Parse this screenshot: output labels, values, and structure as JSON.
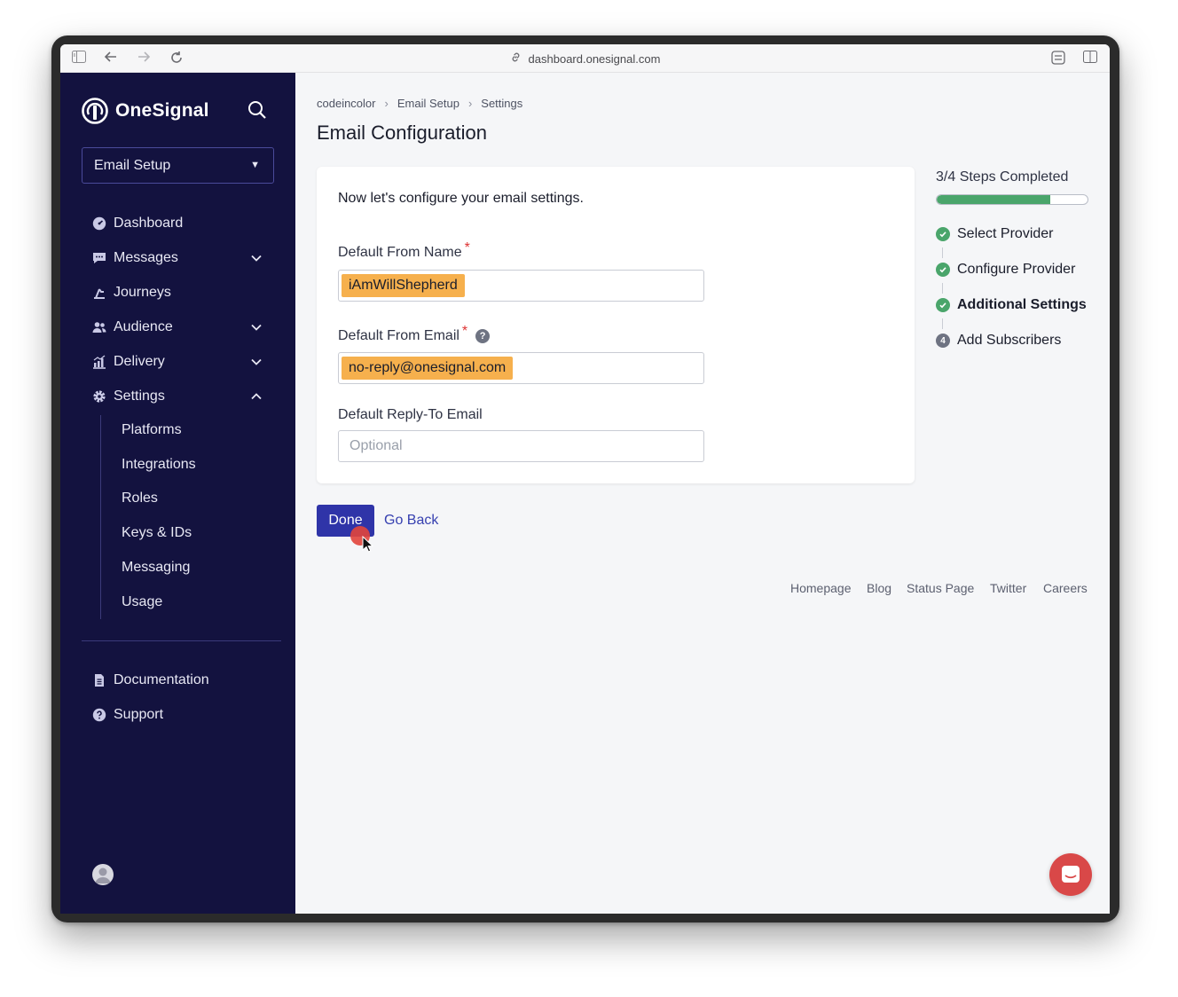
{
  "browser": {
    "url": "dashboard.onesignal.com"
  },
  "sidebar": {
    "brand": "OneSignal",
    "app_selector": "Email Setup",
    "nav": [
      {
        "label": "Dashboard"
      },
      {
        "label": "Messages"
      },
      {
        "label": "Journeys"
      },
      {
        "label": "Audience"
      },
      {
        "label": "Delivery"
      },
      {
        "label": "Settings"
      }
    ],
    "settings_subnav": [
      "Platforms",
      "Integrations",
      "Roles",
      "Keys & IDs",
      "Messaging",
      "Usage"
    ],
    "bottom": [
      {
        "label": "Documentation"
      },
      {
        "label": "Support"
      }
    ]
  },
  "main": {
    "breadcrumb": [
      "codeincolor",
      "Email Setup",
      "Settings"
    ],
    "breadcrumb_sep": "›",
    "title": "Email Configuration",
    "card": {
      "intro": "Now let's configure your email settings.",
      "from_name_label": "Default From Name",
      "from_name_value": "iAmWillShepherd",
      "from_email_label": "Default From Email",
      "from_email_value": "no-reply@onesignal.com",
      "reply_to_label": "Default Reply-To Email",
      "reply_to_placeholder": "Optional",
      "required_mark": "*",
      "help_glyph": "?"
    },
    "done_label": "Done",
    "go_back_label": "Go Back"
  },
  "steps": {
    "summary": "3/4 Steps Completed",
    "progress": 0.75,
    "items": [
      {
        "label": "Select Provider",
        "state": "done"
      },
      {
        "label": "Configure Provider",
        "state": "done"
      },
      {
        "label": "Additional Settings",
        "state": "current"
      },
      {
        "label": "Add Subscribers",
        "state": "pending",
        "number": "4"
      }
    ]
  },
  "footer": [
    "Homepage",
    "Blog",
    "Status Page",
    "Twitter",
    "Careers"
  ],
  "colors": {
    "sidebar_bg": "#13123f",
    "primary": "#2f34a8",
    "success": "#4aa56b",
    "highlight": "#f6b04d",
    "chat": "#d94848"
  },
  "icons": [
    "sidebar-toggle-icon",
    "back-icon",
    "forward-icon",
    "reload-icon",
    "link-icon",
    "extension-icon",
    "split-view-icon",
    "search-icon",
    "dashboard-icon",
    "messages-icon",
    "journeys-icon",
    "audience-icon",
    "delivery-icon",
    "settings-icon",
    "documentation-icon",
    "support-icon",
    "chevron-down-icon",
    "chevron-up-icon",
    "check-icon",
    "help-icon",
    "chat-icon",
    "cursor-icon"
  ]
}
